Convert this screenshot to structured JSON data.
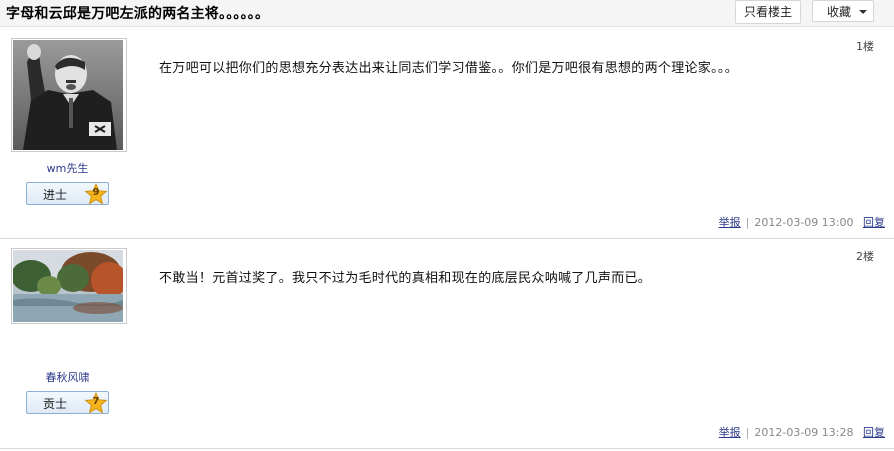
{
  "thread": {
    "title": "字母和云邱是万吧左派的两名主将。。。。。。",
    "only_op_label": "只看楼主",
    "favorite_label": "收藏"
  },
  "posts": [
    {
      "username": "wm先生",
      "rank_label": "进士",
      "rank_level": "9",
      "floor": "1楼",
      "content": "在万吧可以把你们的思想充分表达出来让同志们学习借鉴。。你们是万吧很有思想的两个理论家。。。",
      "report_label": "举报",
      "separator": "|",
      "timestamp": "2012-03-09 13:00",
      "reply_label": "回复"
    },
    {
      "username": "春秋风啸",
      "rank_label": "贡士",
      "rank_level": "7",
      "floor": "2楼",
      "content": "不敢当！元首过奖了。我只不过为毛时代的真相和现在的底层民众呐喊了几声而已。",
      "report_label": "举报",
      "separator": "|",
      "timestamp": "2012-03-09 13:28",
      "reply_label": "回复"
    }
  ],
  "colors": {
    "username": "#2b3a8a",
    "rank_border": "#8fb0d6",
    "star": "#f3b41c",
    "divider": "#d9d9d9"
  }
}
